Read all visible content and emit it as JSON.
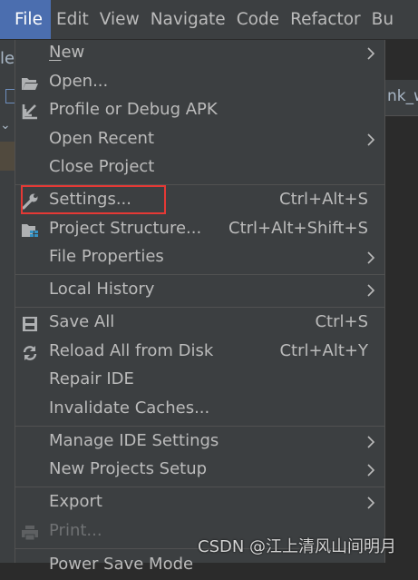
{
  "menubar": {
    "items": [
      "File",
      "Edit",
      "View",
      "Navigate",
      "Code",
      "Refactor",
      "Bu"
    ]
  },
  "background": {
    "left_text": "le",
    "right_text": "nk_w"
  },
  "file_menu": {
    "new": "New",
    "open": "Open...",
    "profile_debug": "Profile or Debug APK",
    "open_recent": "Open Recent",
    "close_project": "Close Project",
    "settings": "Settings...",
    "settings_shortcut": "Ctrl+Alt+S",
    "project_structure": "Project Structure...",
    "project_structure_shortcut": "Ctrl+Alt+Shift+S",
    "file_properties": "File Properties",
    "local_history": "Local History",
    "save_all": "Save All",
    "save_all_shortcut": "Ctrl+S",
    "reload_all": "Reload All from Disk",
    "reload_all_shortcut": "Ctrl+Alt+Y",
    "repair_ide": "Repair IDE",
    "invalidate_caches": "Invalidate Caches...",
    "manage_ide_settings": "Manage IDE Settings",
    "new_projects_setup": "New Projects Setup",
    "export": "Export",
    "print": "Print...",
    "power_save": "Power Save Mode"
  },
  "watermark": "CSDN @江上清风山间明月",
  "colors": {
    "menu_bg": "#3c3f41",
    "active_menu": "#4b6eaf",
    "highlight_border": "#e53935"
  }
}
